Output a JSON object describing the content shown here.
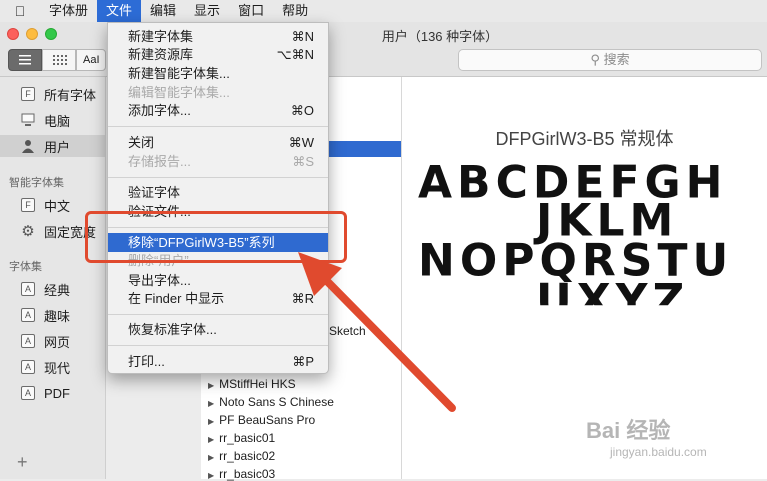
{
  "menubar": {
    "apple_icon": "apple-logo-icon",
    "items": [
      {
        "label": "字体册"
      },
      {
        "label": "文件"
      },
      {
        "label": "编辑"
      },
      {
        "label": "显示"
      },
      {
        "label": "窗口"
      },
      {
        "label": "帮助"
      }
    ],
    "active_index": 1
  },
  "window": {
    "title": "用户（136 种字体）"
  },
  "toolbar": {
    "aa_label": "AaI",
    "search_placeholder": "搜索"
  },
  "sidebar": {
    "items": [
      {
        "label": "所有字体",
        "icon": "font-box-icon"
      },
      {
        "label": "电脑",
        "icon": "computer-icon"
      },
      {
        "label": "用户",
        "icon": "user-icon"
      }
    ],
    "smart_header": "智能字体集",
    "smart_items": [
      {
        "label": "中文",
        "icon": "font-box-icon"
      },
      {
        "label": "固定宽度",
        "icon": "gear-icon"
      }
    ],
    "collections_header": "字体集",
    "collections": [
      {
        "label": "经典"
      },
      {
        "label": "趣味"
      },
      {
        "label": "网页"
      },
      {
        "label": "现代"
      },
      {
        "label": "PDF"
      }
    ],
    "add_label": "+"
  },
  "fontlist": {
    "partial_label": "Sketch",
    "rows": [
      {
        "label": "MStiffHei HKS"
      },
      {
        "label": "Noto Sans S Chinese"
      },
      {
        "label": "PF BeauSans Pro"
      },
      {
        "label": "rr_basic01"
      },
      {
        "label": "rr_basic02"
      },
      {
        "label": "rr_basic03"
      }
    ]
  },
  "preview": {
    "title": "DFPGirlW3-B5 常规体",
    "lines": [
      "ABCDEFGH",
      "JKLM",
      "NOPQRSTU",
      "UXYZ"
    ]
  },
  "file_menu": {
    "items": [
      {
        "label": "新建字体集",
        "shortcut": "⌘N",
        "enabled": true
      },
      {
        "label": "新建资源库",
        "shortcut": "⌥⌘N",
        "enabled": true
      },
      {
        "label": "新建智能字体集...",
        "shortcut": "",
        "enabled": true
      },
      {
        "label": "编辑智能字体集...",
        "shortcut": "",
        "enabled": false
      },
      {
        "label": "添加字体...",
        "shortcut": "⌘O",
        "enabled": true
      },
      {
        "label": "关闭",
        "shortcut": "⌘W",
        "enabled": true
      },
      {
        "label": "存储报告...",
        "shortcut": "⌘S",
        "enabled": false
      },
      {
        "label": "验证字体",
        "shortcut": "",
        "enabled": true
      },
      {
        "label": "验证文件...",
        "shortcut": "",
        "enabled": true
      },
      {
        "label": "移除“DFPGirlW3-B5”系列",
        "shortcut": "",
        "enabled": true
      },
      {
        "label": "删除“用户”",
        "shortcut": "",
        "enabled": false
      },
      {
        "label": "导出字体...",
        "shortcut": "",
        "enabled": true
      },
      {
        "label": "在 Finder 中显示",
        "shortcut": "⌘R",
        "enabled": true
      },
      {
        "label": "恢复标准字体...",
        "shortcut": "",
        "enabled": true
      },
      {
        "label": "打印...",
        "shortcut": "⌘P",
        "enabled": true
      }
    ],
    "highlighted_index": 9
  },
  "annotation": {
    "color": "#e04a2e"
  },
  "watermark": {
    "line1": "Bai 经验",
    "line2": "jingyan.baidu.com"
  }
}
